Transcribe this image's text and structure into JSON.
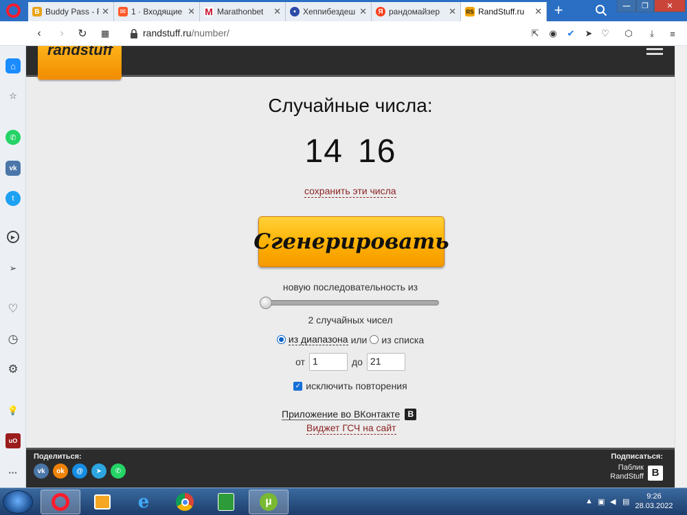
{
  "browser": {
    "tabs": [
      {
        "label": "Buddy Pass - F",
        "icon": "buddy-favicon",
        "color": "#e8a317",
        "glyph": "B"
      },
      {
        "label": "1 · Входящие",
        "icon": "mail-favicon",
        "color": "#ff5a2a",
        "glyph": "M"
      },
      {
        "label": "Marathonbet",
        "icon": "marathon-favicon",
        "color": "#c8102e",
        "glyph": "M"
      },
      {
        "label": "Хеппибездеш",
        "icon": "hb-favicon",
        "color": "#2d4aa8",
        "glyph": "Ж"
      },
      {
        "label": "рандомайзер",
        "icon": "yandex-favicon",
        "color": "#fc3f1d",
        "glyph": "Я"
      },
      {
        "label": "RandStuff.ru",
        "icon": "randstuff-favicon",
        "color": "#f0a400",
        "glyph": "RS"
      }
    ],
    "new_tab": "+",
    "url": {
      "host": "randstuff.ru",
      "path": "/number/"
    }
  },
  "page": {
    "title": "Случайные числа:",
    "numbers": [
      "14",
      "16"
    ],
    "save_link": "сохранить эти числа",
    "generate_label": "Сгенерировать",
    "sequence_label": "новую последовательность из",
    "slider_value": 2,
    "count_label": "2 случайных чисел",
    "mode": {
      "range_label": "из диапазона",
      "or": "или",
      "list_label": "из списка",
      "selected": "range"
    },
    "range": {
      "from_label": "от",
      "from": "1",
      "to_label": "до",
      "to": "21"
    },
    "exclude_repeats": {
      "label": "исключить повторения",
      "checked": true
    },
    "vk_app_link": "Приложение во ВКонтакте",
    "vk_glyph": "В",
    "widget_link": "Виджет ГСЧ на сайт"
  },
  "footer": {
    "share_label": "Поделиться:",
    "share_icons": [
      {
        "name": "vk-share-icon",
        "color": "#4a76a8",
        "glyph": "vk"
      },
      {
        "name": "ok-share-icon",
        "color": "#ee8208",
        "glyph": "ok"
      },
      {
        "name": "moimir-share-icon",
        "color": "#168de2",
        "glyph": "@"
      },
      {
        "name": "telegram-share-icon",
        "color": "#2ca5e0",
        "glyph": "➤"
      },
      {
        "name": "whatsapp-share-icon",
        "color": "#25d366",
        "glyph": "✆"
      }
    ],
    "subscribe_label": "Подписаться:",
    "public_label_1": "Паблик",
    "public_label_2": "RandStuff",
    "public_glyph": "В"
  },
  "taskbar": {
    "time": "9:26",
    "date": "28.03.2022"
  },
  "colors": {
    "accent": "#ffb000",
    "link": "#8b2323",
    "header": "#2c2c2c",
    "tabbar": "#2a6fc4"
  }
}
